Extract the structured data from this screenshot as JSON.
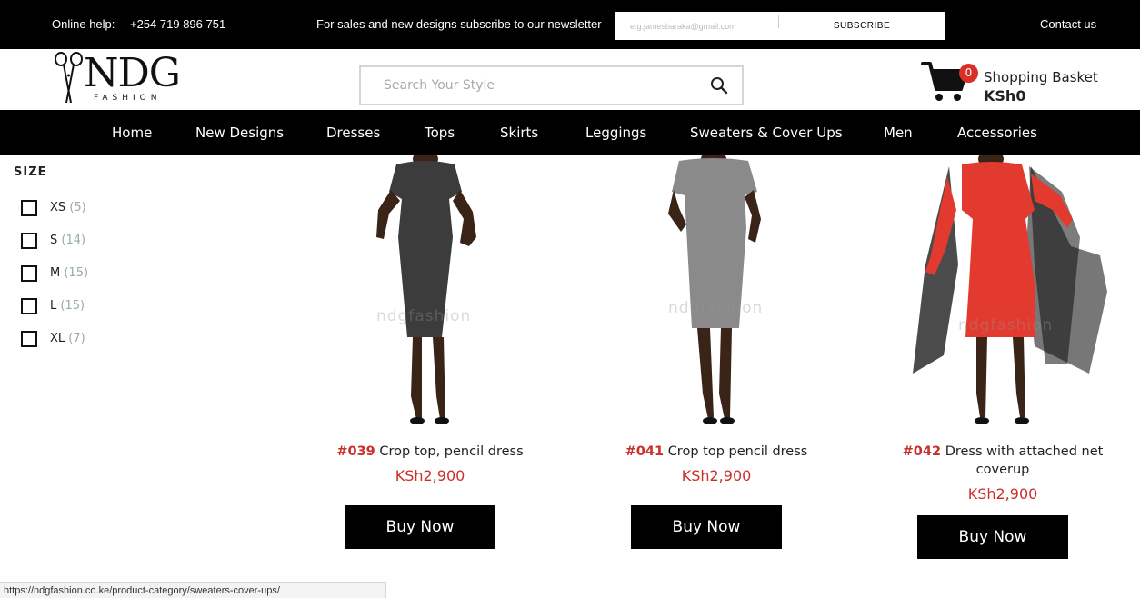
{
  "topbar": {
    "help_label": "Online help:",
    "phone": "+254 719 896 751",
    "promo": "For sales and new designs subscribe to our newsletter",
    "newsletter_placeholder": "e.g.jamesbaraka@gmail.com",
    "subscribe_label": "SUBSCRIBE",
    "contact_label": "Contact us"
  },
  "logo": {
    "name": "NDG",
    "sub": "FASHION"
  },
  "search": {
    "placeholder": "Search Your Style",
    "icon": "search-icon"
  },
  "cart": {
    "count": "0",
    "label": "Shopping Basket",
    "total": "KSh0",
    "icon": "cart-icon"
  },
  "nav": {
    "items": [
      {
        "label": "Home"
      },
      {
        "label": "New Designs"
      },
      {
        "label": "Dresses"
      },
      {
        "label": "Tops"
      },
      {
        "label": "Skirts"
      },
      {
        "label": "Leggings"
      },
      {
        "label": "Sweaters & Cover Ups"
      },
      {
        "label": "Men"
      },
      {
        "label": "Accessories"
      }
    ]
  },
  "filter": {
    "title": "SIZE",
    "sizes": [
      {
        "label": "XS",
        "count": "(5)"
      },
      {
        "label": "S",
        "count": "(14)"
      },
      {
        "label": "M",
        "count": "(15)"
      },
      {
        "label": "L",
        "count": "(15)"
      },
      {
        "label": "XL",
        "count": "(7)"
      }
    ]
  },
  "products": [
    {
      "code": "#039",
      "name": "Crop top, pencil dress",
      "price": "KSh2,900",
      "button": "Buy Now",
      "watermark": "ndgfashion"
    },
    {
      "code": "#041",
      "name": "Crop top pencil dress",
      "price": "KSh2,900",
      "button": "Buy Now",
      "watermark": "ndgfashion"
    },
    {
      "code": "#042",
      "name": "Dress with attached net coverup",
      "price": "KSh2,900",
      "button": "Buy Now",
      "watermark": "ndgfashion"
    }
  ],
  "statusbar": {
    "url": "https://ndgfashion.co.ke/product-category/sweaters-cover-ups/"
  },
  "colors": {
    "accent": "#c9302c",
    "bar": "#000000",
    "badge": "#d9302a"
  }
}
